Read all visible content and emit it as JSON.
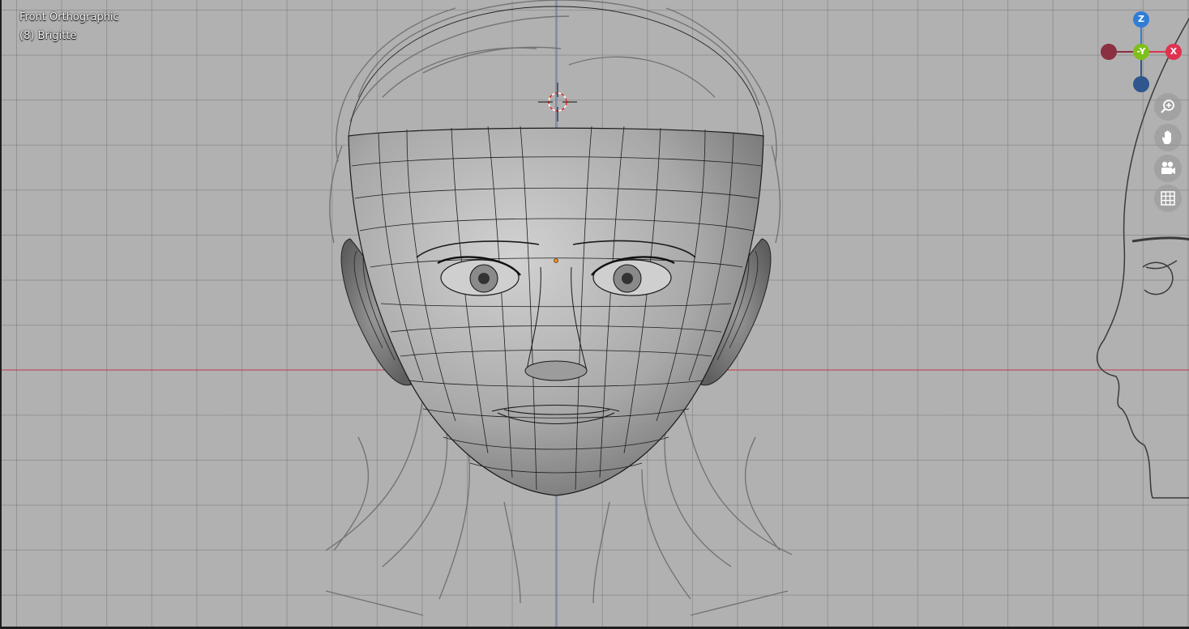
{
  "viewport": {
    "view_name": "Front Orthographic",
    "object_label": "(8) Brigitte",
    "background": "#b1b1b1",
    "x_axis_color": "#c0424f",
    "z_axis_color": "#4d6fa8"
  },
  "gizmo": {
    "z_label": "Z",
    "neg_y_label": "-Y",
    "x_label": "X",
    "z_color": "#2f7dd6",
    "y_color": "#7fbf1a",
    "x_color": "#e0324f",
    "neg_color_x": "#8a3040",
    "neg_color_z": "#2f568f"
  },
  "nav_buttons": [
    {
      "name": "zoom",
      "icon": "zoom-icon"
    },
    {
      "name": "pan",
      "icon": "hand-icon"
    },
    {
      "name": "camera",
      "icon": "camera-icon"
    },
    {
      "name": "perspective",
      "icon": "grid-icon"
    }
  ]
}
